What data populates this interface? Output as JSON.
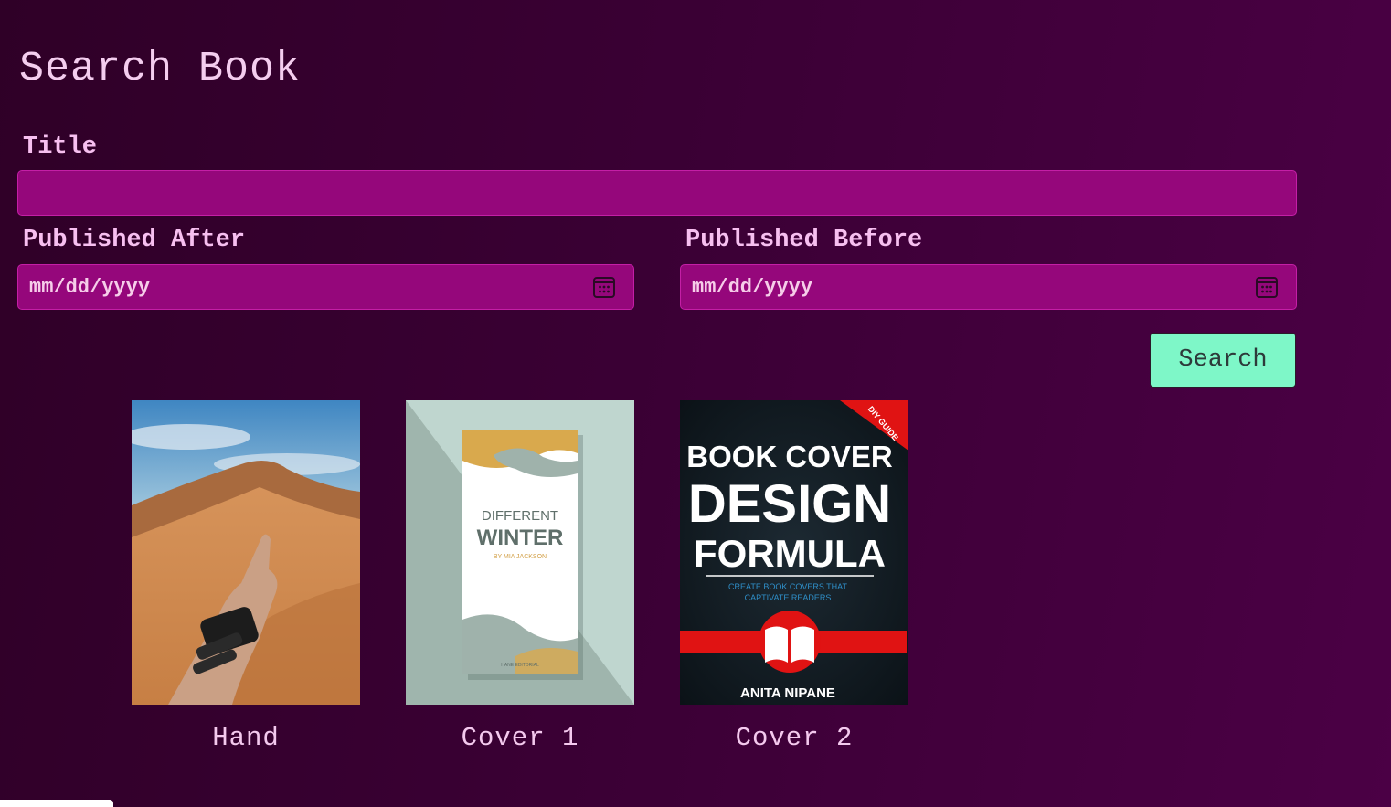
{
  "page": {
    "title": "Search Book"
  },
  "form": {
    "title_label": "Title",
    "title_value": "",
    "published_after_label": "Published After",
    "published_after_placeholder": "mm/dd/yyyy",
    "published_before_label": "Published Before",
    "published_before_placeholder": "mm/dd/yyyy",
    "search_label": "Search"
  },
  "books": [
    {
      "caption": "Hand",
      "cover": "desert-hand-photo"
    },
    {
      "caption": "Cover 1",
      "cover": "different-winter-book",
      "cover_text": {
        "title_line1": "DIFFERENT",
        "title_line2": "WINTER",
        "author": "BY MIA JACKSON",
        "publisher": "HANE EDITORIAL"
      }
    },
    {
      "caption": "Cover 2",
      "cover": "book-cover-design-formula",
      "cover_text": {
        "banner": "DIY GUIDE",
        "line1": "BOOK COVER",
        "line2": "DESIGN",
        "line3": "FORMULA",
        "subtitle1": "CREATE BOOK COVERS THAT",
        "subtitle2": "CAPTIVATE READERS",
        "author": "ANITA NIPANE"
      }
    }
  ],
  "colors": {
    "background": "#3a0034",
    "input_fill": "#95077b",
    "button_fill": "#7ef7c8",
    "label_text": "#f7bff0"
  }
}
